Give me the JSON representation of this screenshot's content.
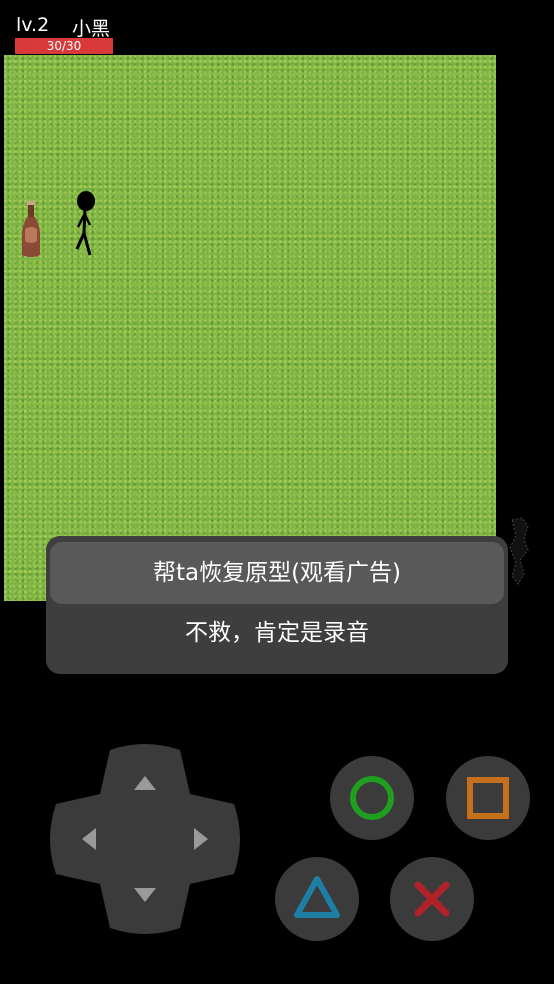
{
  "hud": {
    "level": "lv.2",
    "name": "小黑",
    "hp_text": "30/30",
    "hp_fraction": 1.0
  },
  "dialog": {
    "options": [
      "帮ta恢复原型(观看广告)",
      "不救，肯定是录音"
    ],
    "selected_index": 0
  },
  "controls": {
    "dpad": [
      "up-arrow-icon",
      "down-arrow-icon",
      "left-arrow-icon",
      "right-arrow-icon"
    ],
    "buttons": {
      "circle": {
        "icon": "circle-icon",
        "color": "#1f9e1f"
      },
      "square": {
        "icon": "square-icon",
        "color": "#c7701b"
      },
      "triangle": {
        "icon": "triangle-icon",
        "color": "#1e7fa6"
      },
      "cross": {
        "icon": "cross-icon",
        "color": "#b0222a"
      }
    }
  },
  "colors": {
    "grass": "#7cb342",
    "hp_bar": "#d8393b",
    "menu_bg": "#3e3e3e",
    "menu_selected": "#595959"
  }
}
